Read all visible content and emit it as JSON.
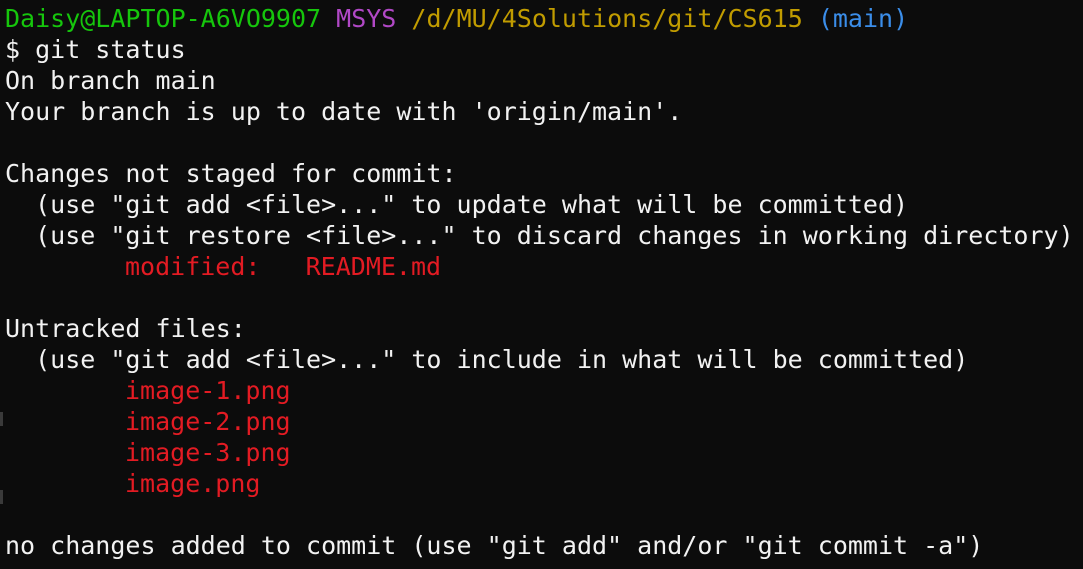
{
  "prompt": {
    "user_host": "Daisy@LAPTOP-A6VO9907",
    "env": "MSYS",
    "path": "/d/MU/4Solutions/git/CS615",
    "branch": "(main)"
  },
  "command": "$ git status",
  "output": {
    "on_branch": "On branch main",
    "up_to_date": "Your branch is up to date with 'origin/main'.",
    "changes_header": "Changes not staged for commit:",
    "changes_hint_add": "  (use \"git add <file>...\" to update what will be committed)",
    "changes_hint_restore": "  (use \"git restore <file>...\" to discard changes in working directory)",
    "modified_label": "modified:   ",
    "modified_file": "README.md",
    "untracked_header": "Untracked files:",
    "untracked_hint": "  (use \"git add <file>...\" to include in what will be committed)",
    "untracked_files": [
      "image-1.png",
      "image-2.png",
      "image-3.png",
      "image.png"
    ],
    "summary": "no changes added to commit (use \"git add\" and/or \"git commit -a\")"
  },
  "colors": {
    "background": "#0c0c0c",
    "foreground": "#f2f2f2",
    "user_host": "#16c60c",
    "env": "#b148c6",
    "path": "#c19c00",
    "branch": "#3b8eea",
    "changed": "#e31b23"
  }
}
